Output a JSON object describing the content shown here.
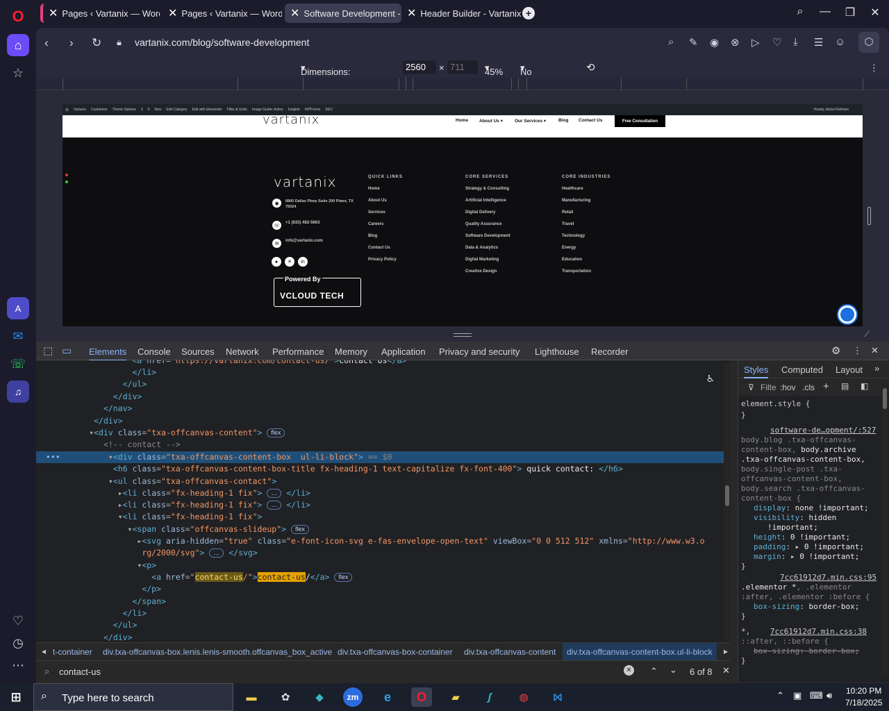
{
  "browser": {
    "tabs": [
      {
        "title": "Pages ‹ Vartanix — WordP"
      },
      {
        "title": "Pages ‹ Vartanix — WordP"
      },
      {
        "title": "Software Development - V"
      },
      {
        "title": "Header Builder - Vartanix"
      }
    ],
    "url": "vartanix.com/blog/software-development"
  },
  "device_toolbar": {
    "dimensions_label": "Dimensions: Responsive",
    "width": "2560",
    "height": "711",
    "zoom": "45%",
    "throttling": "No throttling"
  },
  "site": {
    "admin_bar": [
      "Vartanix",
      "Customize",
      "Theme Options",
      "3",
      "0",
      "New",
      "Edit Category",
      "Edit with Elementor",
      "Filter & Grids",
      "Image Guide: Active",
      "Insights",
      "WPForms",
      "SEO"
    ],
    "admin_howdy": "Howdy, Abdul Rehman",
    "logo": "vartanix",
    "menu": [
      "Home",
      "About Us",
      "Our Services",
      "Blog",
      "Contact Us"
    ],
    "cta": "Free Consultation",
    "footer": {
      "address": "6860 Dallas Pkwy Suite 200 Plano, TX 75024",
      "phone": "+1 (833) 482-5663",
      "email": "info@vartanix.com",
      "powered_by": "Powered By",
      "powered_brand": "VCLOUD TECH",
      "quick_links_title": "QUICK LINKS",
      "quick_links": [
        "Home",
        "About Us",
        "Services",
        "Careers",
        "Blog",
        "Contact Us",
        "Privacy Policy"
      ],
      "services_title": "CORE SERVICES",
      "services": [
        "Strategy & Consulting",
        "Artificial Intelligence",
        "Digital Delivery",
        "Quality Assurance",
        "Software Development",
        "Data & Analytics",
        "Digital Marketing",
        "Creative Design"
      ],
      "industries_title": "CORE INDUSTRIES",
      "industries": [
        "Healthcare",
        "Manufacturing",
        "Retail",
        "Travel",
        "Technology",
        "Energy",
        "Education",
        "Transportation"
      ]
    }
  },
  "devtools": {
    "tabs": [
      "Elements",
      "Console",
      "Sources",
      "Network",
      "Performance",
      "Memory",
      "Application",
      "Privacy and security",
      "Lighthouse",
      "Recorder"
    ],
    "styles_tabs": [
      "Styles",
      "Computed",
      "Layout"
    ],
    "filter_placeholder": "Filte",
    "hov": ":hov",
    "cls": ".cls",
    "breadcrumbs": [
      "t-container",
      "div.txa-offcanvas-box.lenis.lenis-smooth.offcanvas_box_active",
      "div.txa-offcanvas-box-container",
      "div.txa-offcanvas-content",
      "div.txa-offcanvas-content-box.ul-li-block"
    ],
    "search_value": "contact-us",
    "search_count": "6 of 8",
    "flex_badge": "flex",
    "selected_suffix": " == $0"
  },
  "taskbar": {
    "search_placeholder": "Type here to search",
    "time": "10:20 PM",
    "date": "7/18/2025"
  }
}
